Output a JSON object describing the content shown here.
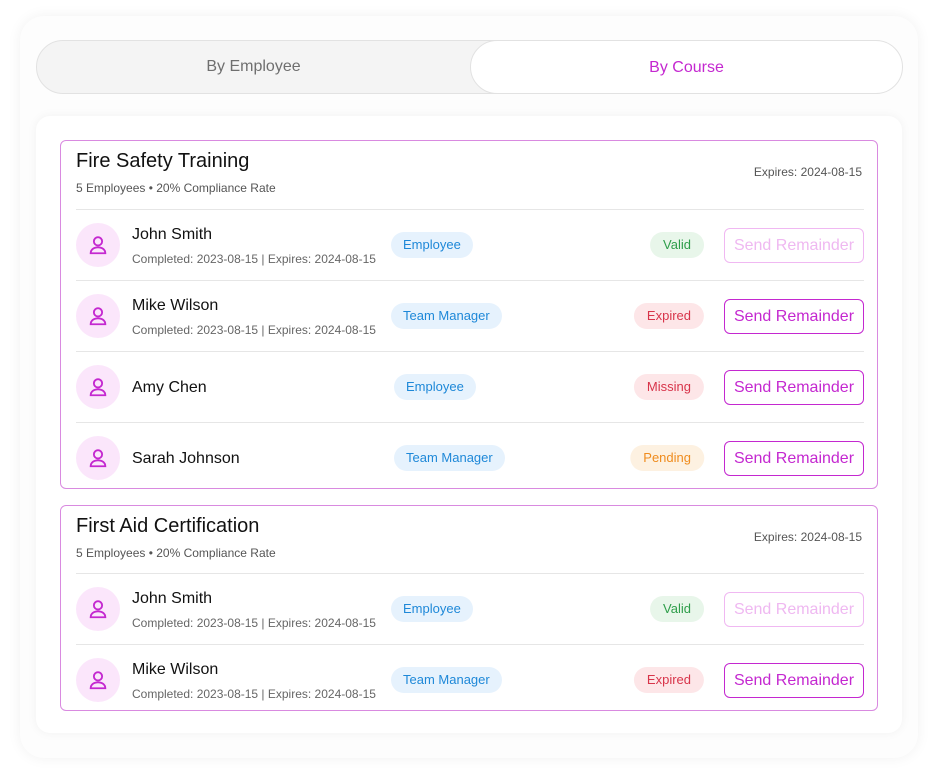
{
  "tabs": {
    "by_employee": "By Employee",
    "by_course": "By Course",
    "active": "by_course"
  },
  "colors": {
    "accent": "#c428d0",
    "role_bg": "#e6f2fd",
    "role_text": "#1e88d8",
    "valid_bg": "#e8f6ea",
    "valid_text": "#2e9e4a",
    "expired_bg": "#fde6e8",
    "expired_text": "#d8344a",
    "missing_bg": "#fde6e8",
    "missing_text": "#d8344a",
    "pending_bg": "#fdf1e1",
    "pending_text": "#ef8c1e"
  },
  "courses": [
    {
      "title": "Fire Safety Training",
      "subtitle": "5 Employees • 20% Compliance Rate",
      "expires": "Expires: 2024-08-15",
      "rows": [
        {
          "name": "John Smith",
          "meta": "Completed: 2023-08-15 | Expires: 2024-08-15",
          "role": "Employee",
          "status": "Valid",
          "status_kind": "valid",
          "button": "Send Remainder",
          "button_enabled": false
        },
        {
          "name": "Mike Wilson",
          "meta": "Completed: 2023-08-15 | Expires: 2024-08-15",
          "role": "Team Manager",
          "status": "Expired",
          "status_kind": "expired",
          "button": "Send Remainder",
          "button_enabled": true
        },
        {
          "name": "Amy Chen",
          "meta": "",
          "role": "Employee",
          "status": "Missing",
          "status_kind": "missing",
          "button": "Send Remainder",
          "button_enabled": true
        },
        {
          "name": "Sarah Johnson",
          "meta": "",
          "role": "Team Manager",
          "status": "Pending",
          "status_kind": "pending",
          "button": "Send Remainder",
          "button_enabled": true
        }
      ]
    },
    {
      "title": "First Aid Certification",
      "subtitle": "5 Employees • 20% Compliance Rate",
      "expires": "Expires: 2024-08-15",
      "rows": [
        {
          "name": "John Smith",
          "meta": "Completed: 2023-08-15 | Expires: 2024-08-15",
          "role": "Employee",
          "status": "Valid",
          "status_kind": "valid",
          "button": "Send Remainder",
          "button_enabled": false
        },
        {
          "name": "Mike Wilson",
          "meta": "Completed: 2023-08-15 | Expires: 2024-08-15",
          "role": "Team Manager",
          "status": "Expired",
          "status_kind": "expired",
          "button": "Send Remainder",
          "button_enabled": true
        }
      ]
    }
  ]
}
